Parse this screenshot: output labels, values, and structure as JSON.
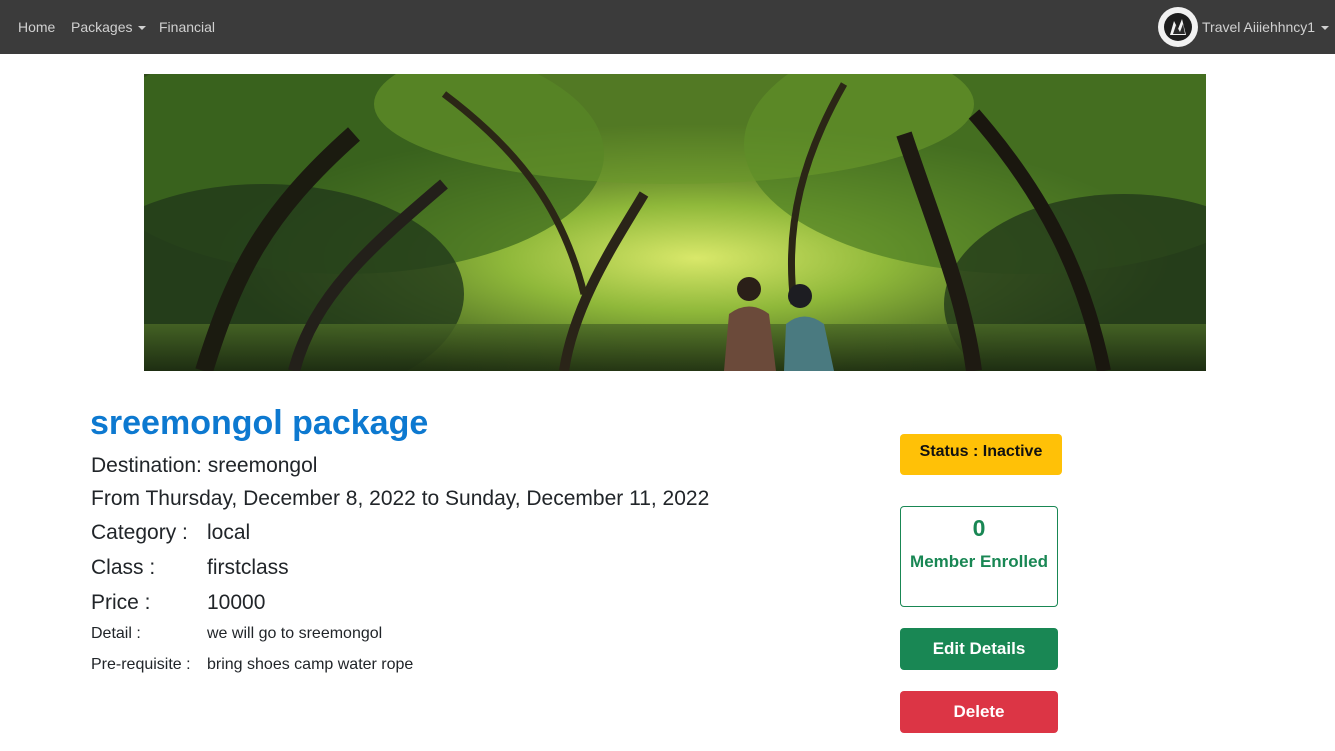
{
  "navbar": {
    "links": {
      "home": "Home",
      "packages": "Packages",
      "financial": "Financial"
    },
    "user": {
      "name": "Travel Aiiiehhncy1"
    }
  },
  "package": {
    "title": "sreemongol package",
    "destination": "Destination: sreemongol",
    "dates": "From Thursday, December 8, 2022 to Sunday, December 11, 2022",
    "category_label": "Category :",
    "category_value": "local",
    "class_label": "Class :",
    "class_value": "firstclass",
    "price_label": "Price :",
    "price_value": "10000",
    "detail_label": "Detail :",
    "detail_value": "we will go to sreemongol",
    "prereq_label": "Pre-requisite :",
    "prereq_value": "bring shoes camp water rope"
  },
  "panel": {
    "status": "Status : Inactive",
    "member_count": "0",
    "member_label": "Member Enrolled",
    "edit_label": "Edit Details",
    "delete_label": "Delete"
  },
  "colors": {
    "navbar": "#3b3b3b",
    "title": "#0d79d0",
    "status_warning": "#ffc107",
    "success": "#198754",
    "danger": "#dc3545"
  },
  "icons": {
    "user_avatar": "avatar-icon",
    "dropdown": "caret-down-icon"
  }
}
